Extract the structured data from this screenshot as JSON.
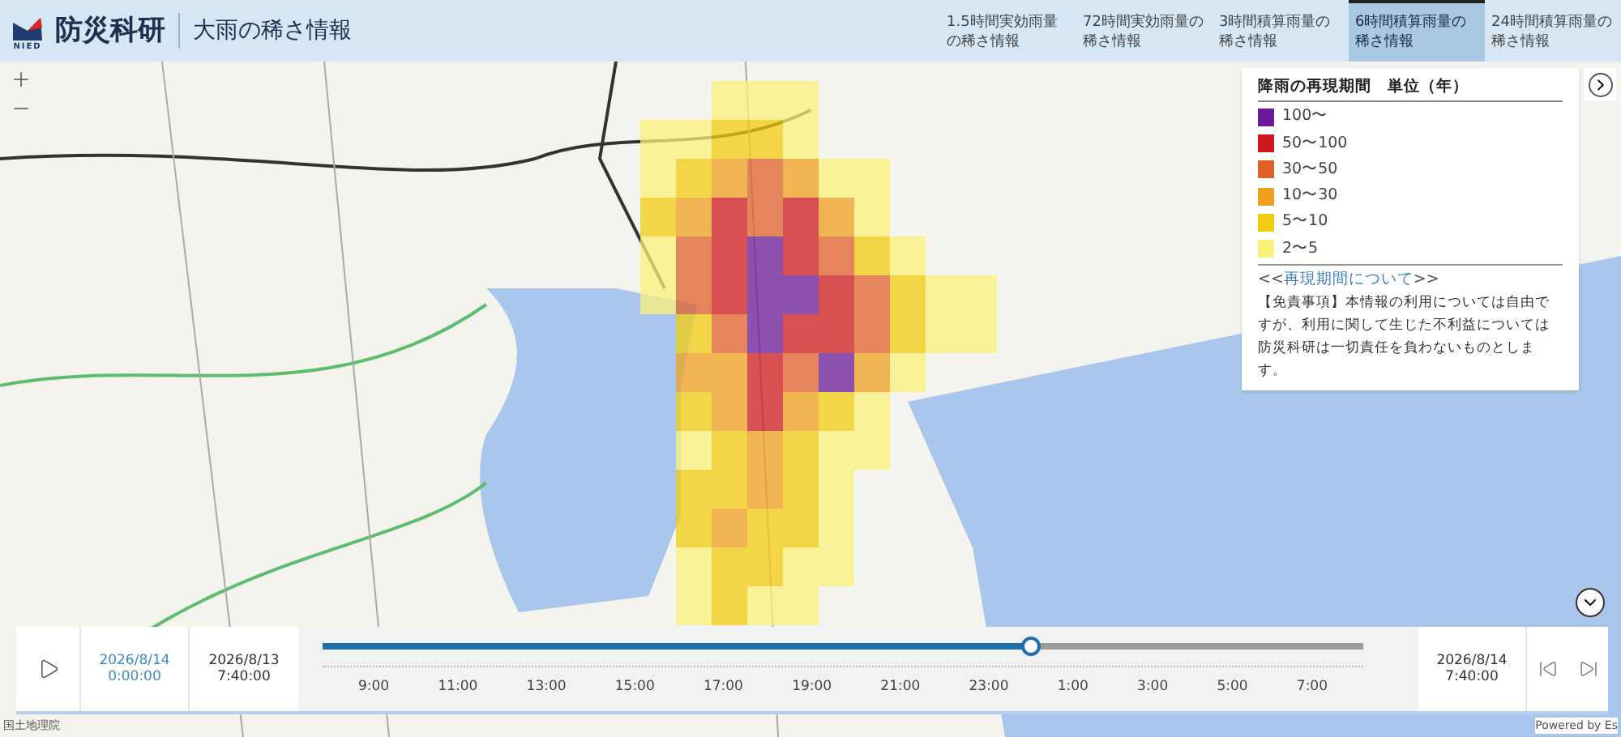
{
  "header": {
    "logo_text": "防災科研",
    "logo_sub": "NIED",
    "title": "大雨の稀さ情報"
  },
  "tabs": [
    {
      "label": "1.5時間実効雨量の稀さ情報",
      "selected": false
    },
    {
      "label": "72時間実効雨量の稀さ情報",
      "selected": false
    },
    {
      "label": "3時間積算雨量の稀さ情報",
      "selected": false
    },
    {
      "label": "6時間積算雨量の稀さ情報",
      "selected": true
    },
    {
      "label": "24時間積算雨量の稀さ情報",
      "selected": false
    }
  ],
  "legend": {
    "title": "降雨の再現期間　単位（年）",
    "items": [
      {
        "label": "100〜",
        "color": "#6a1b9a"
      },
      {
        "label": "50〜100",
        "color": "#d0191f"
      },
      {
        "label": "30〜50",
        "color": "#e0602a"
      },
      {
        "label": "10〜30",
        "color": "#f0a020"
      },
      {
        "label": "5〜10",
        "color": "#f2cc10"
      },
      {
        "label": "2〜5",
        "color": "#fbf27a"
      }
    ],
    "link_prefix": "<<",
    "link": "再現期間について",
    "link_suffix": ">>",
    "disclaimer": "【免責事項】本情報の利用については自由ですが、利用に関して生じた不利益については防災科研は一切責任を負わないものとします。"
  },
  "timeline": {
    "current_date": "2026/8/14",
    "current_time": "0:00:00",
    "start_date": "2026/8/13",
    "start_time": "7:40:00",
    "end_date": "2026/8/14",
    "end_time": "7:40:00",
    "level": 0.68,
    "ticks": [
      "9:00",
      "11:00",
      "13:00",
      "15:00",
      "17:00",
      "19:00",
      "21:00",
      "23:00",
      "1:00",
      "3:00",
      "5:00",
      "7:00"
    ]
  },
  "attribution_left": "国土地理院",
  "attribution_right": "Powered by Es"
}
